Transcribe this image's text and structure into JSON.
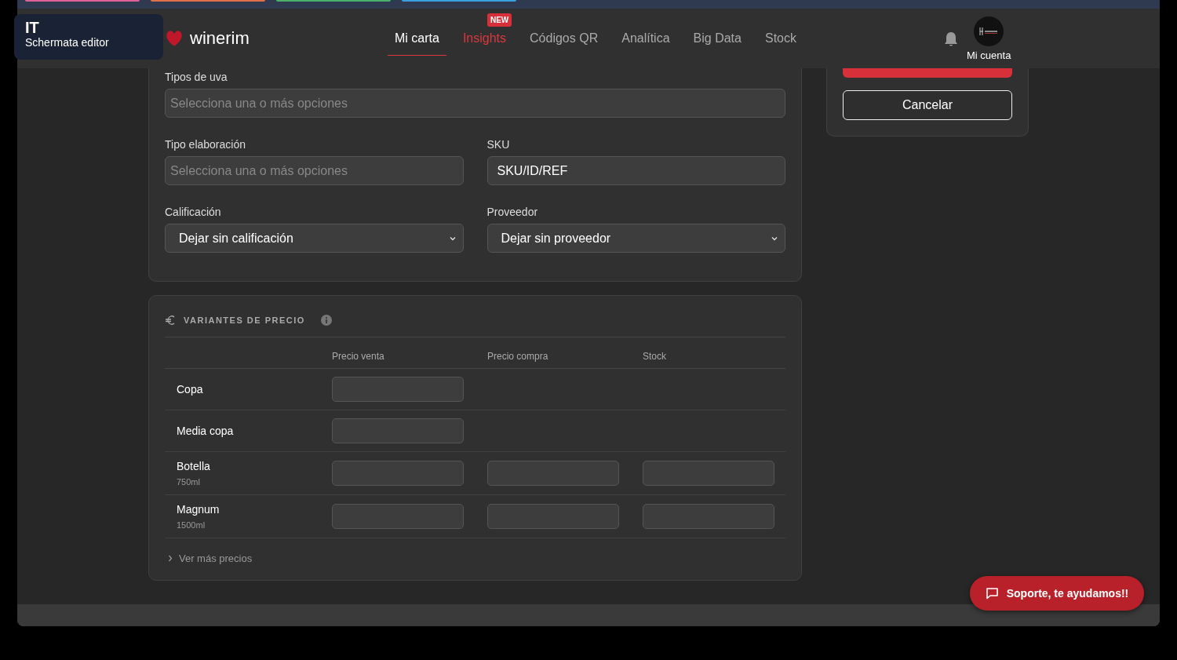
{
  "overlay_badge": {
    "code": "IT",
    "label": "Schermata editor"
  },
  "browser_tabs": [
    {
      "color": "#e0609a"
    },
    {
      "color": "#e0704a"
    },
    {
      "color": "#4caf6a"
    },
    {
      "color": "#3aa0e0"
    }
  ],
  "brand": {
    "name": "winerim"
  },
  "nav": [
    {
      "label": "Mi carta",
      "selected": true,
      "kind": "link"
    },
    {
      "label": "Insights",
      "selected": false,
      "kind": "featured",
      "badge": "NEW"
    },
    {
      "label": "Códigos QR",
      "selected": false,
      "kind": "link"
    },
    {
      "label": "Analítica",
      "selected": false,
      "kind": "link"
    },
    {
      "label": "Big Data",
      "selected": false,
      "kind": "link"
    },
    {
      "label": "Stock",
      "selected": false,
      "kind": "link"
    }
  ],
  "account": {
    "label": "Mi cuenta"
  },
  "form": {
    "rows": [
      [
        {
          "label": "Tipos de uva",
          "kind": "multiselect",
          "placeholder": "Selecciona una o más opciones"
        }
      ],
      [
        {
          "label": "Tipo elaboración",
          "kind": "multiselect",
          "placeholder": "Selecciona una o más opciones"
        },
        {
          "label": "SKU",
          "kind": "text",
          "value": "SKU/ID/REF"
        }
      ],
      [
        {
          "label": "Calificación",
          "kind": "select",
          "value": "Dejar sin calificación"
        },
        {
          "label": "Proveedor",
          "kind": "select",
          "value": "Dejar sin proveedor"
        }
      ]
    ]
  },
  "prices": {
    "title": "VARIANTES DE PRECIO",
    "columns": [
      "Precio venta",
      "Precio compra",
      "Stock"
    ],
    "rows": [
      {
        "name": "Copa",
        "inputs": [
          true,
          false,
          false
        ]
      },
      {
        "name": "Media copa",
        "inputs": [
          true,
          false,
          false
        ]
      },
      {
        "name": "Botella",
        "size": "750ml",
        "inputs": [
          true,
          true,
          true
        ]
      },
      {
        "name": "Magnum",
        "size": "1500ml",
        "inputs": [
          true,
          true,
          true
        ]
      }
    ],
    "more": "Ver más precios"
  },
  "actions": {
    "cancel": "Cancelar"
  },
  "support": {
    "label": "Soporte, te ayudamos!!"
  }
}
